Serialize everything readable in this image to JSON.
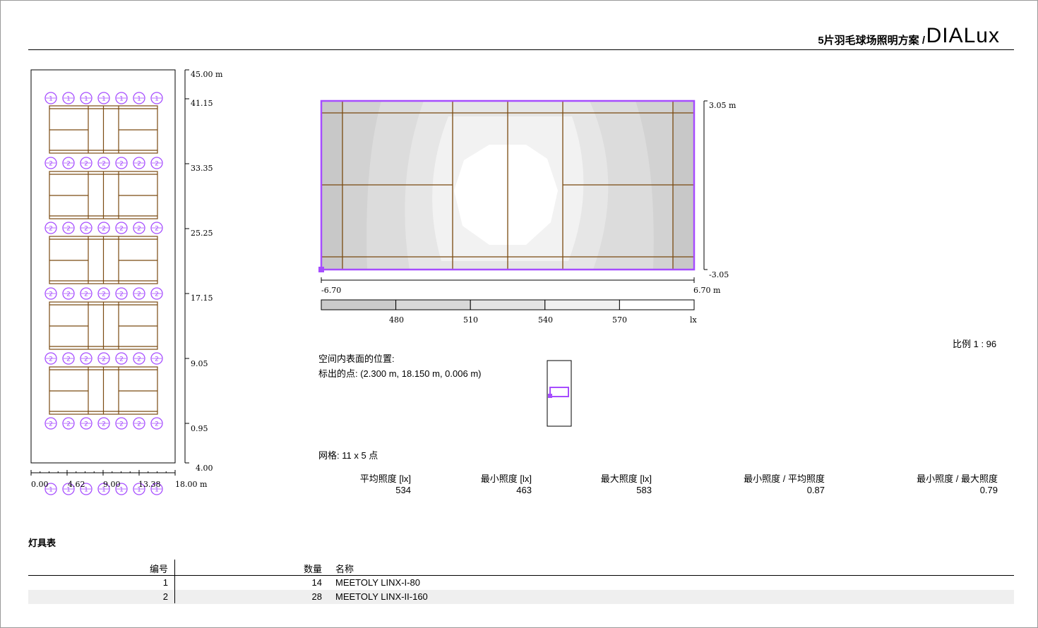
{
  "header": {
    "title": "5片羽毛球场照明方案 /",
    "brand": "DIALux"
  },
  "plan": {
    "y_ticks": [
      "45.00 m",
      "41.15",
      "33.35",
      "25.25",
      "17.15",
      "9.05",
      "0.95",
      "4.00"
    ],
    "x_ticks": [
      "0.00",
      "4.62",
      "9.00",
      "13.38",
      "18.00 m"
    ],
    "luminaire_rows": [
      "1",
      "2",
      "2",
      "2",
      "2",
      "2",
      "1"
    ]
  },
  "iso": {
    "y_top": "3.05 m",
    "y_bottom": "-3.05",
    "x_left": "-6.70",
    "x_right": "6.70 m",
    "scale_labels": [
      "480",
      "510",
      "540",
      "570",
      "lx"
    ],
    "scale_colors": [
      "#cbcbcb",
      "#d8d8d8",
      "#e4e4e4",
      "#f0f0f0",
      "#ffffff"
    ]
  },
  "scale_text": "比例 1 : 96",
  "position": {
    "label": "空间内表面的位置:",
    "point": "标出的点: (2.300 m, 18.150 m, 0.006 m)"
  },
  "grid_text": "网格: 11 x 5 点",
  "stats": [
    {
      "label": "平均照度 [lx]",
      "value": "534"
    },
    {
      "label": "最小照度 [lx]",
      "value": "463"
    },
    {
      "label": "最大照度 [lx]",
      "value": "583"
    },
    {
      "label": "最小照度 / 平均照度",
      "value": "0.87"
    },
    {
      "label": "最小照度 / 最大照度",
      "value": "0.79"
    }
  ],
  "luminaire_table": {
    "title": "灯具表",
    "headers": {
      "id": "编号",
      "qty": "数量",
      "name": "名称"
    },
    "rows": [
      {
        "id": "1",
        "qty": "14",
        "name": "MEETOLY LINX-I-80"
      },
      {
        "id": "2",
        "qty": "28",
        "name": "MEETOLY LINX-II-160"
      }
    ]
  },
  "colors": {
    "accent": "#a64dff",
    "court_line": "#7a4a10"
  }
}
